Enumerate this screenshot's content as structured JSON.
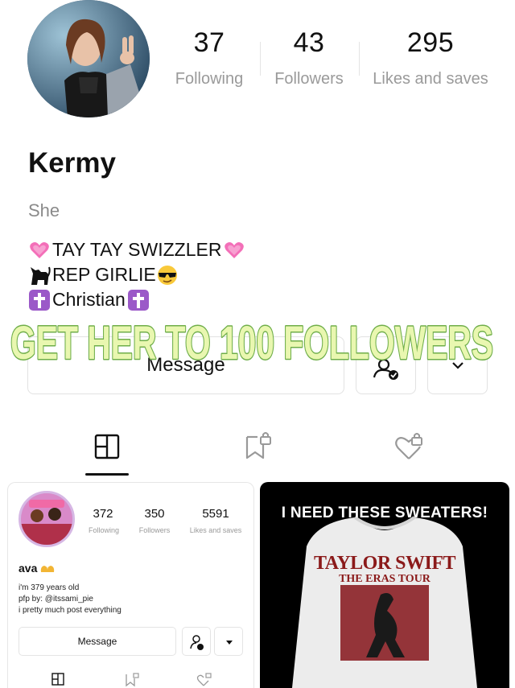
{
  "profile": {
    "name": "Kermy",
    "pronoun": "She",
    "stats": [
      {
        "value": "37",
        "label": "Following"
      },
      {
        "value": "43",
        "label": "Followers"
      },
      {
        "value": "295",
        "label": "Likes and saves"
      }
    ],
    "bio": [
      {
        "before": "pink-heart",
        "text": "TAY TAY SWIZZLER",
        "after": "pink-heart"
      },
      {
        "before": "black-cat",
        "text": "REP GIRLIE",
        "after": "sunglasses-face"
      },
      {
        "before": "latin-cross",
        "text": "Christian",
        "after": "latin-cross"
      }
    ]
  },
  "actions": {
    "message_label": "Message"
  },
  "overlay_text": "GET HER TO 100 FOLLOWERS",
  "tabs": [
    {
      "icon": "notes-grid-icon",
      "active": true
    },
    {
      "icon": "saved-bookmark-lock-icon",
      "active": false
    },
    {
      "icon": "liked-heart-lock-icon",
      "active": false
    }
  ],
  "cards": {
    "left": {
      "stats": [
        {
          "value": "372",
          "label": "Following"
        },
        {
          "value": "350",
          "label": "Followers"
        },
        {
          "value": "5591",
          "label": "Likes and saves"
        }
      ],
      "name": "ava",
      "bio": [
        "i'm 379 years old",
        "pfp by: @itssami_pie",
        "i pretty much post everything"
      ],
      "message_label": "Message"
    },
    "right": {
      "title": "I NEED THESE SWEATERS!",
      "print_line1": "TAYLOR SWIFT",
      "print_line2": "THE ERAS TOUR"
    }
  },
  "colors": {
    "overlay_fill": "#e9f7b0",
    "overlay_stroke": "#6fae4a",
    "muted": "#9a9a9a",
    "sweater_red": "#8b1a1a"
  }
}
